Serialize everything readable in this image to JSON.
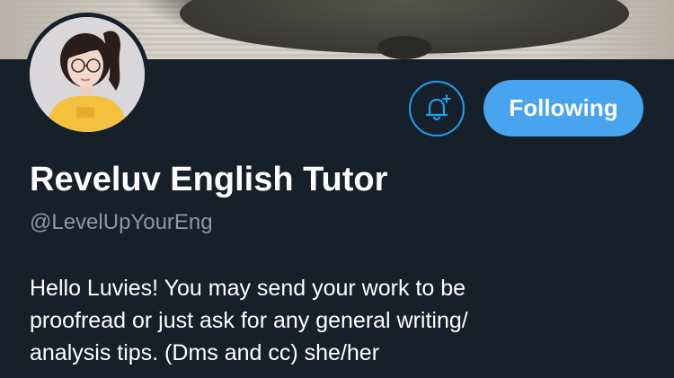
{
  "profile": {
    "name": "Reveluv English Tutor",
    "handle": "@LevelUpYourEng",
    "bio_lines": [
      "Hello Luvies! You may send your work to be",
      "proofread or just ask for any general writing/",
      "analysis tips. (Dms and cc) she/her"
    ]
  },
  "actions": {
    "notify_icon": "bell-plus-icon",
    "follow_label": "Following"
  },
  "colors": {
    "background": "#15202b",
    "accent": "#48a4ef",
    "handle_text": "#8899a6"
  }
}
